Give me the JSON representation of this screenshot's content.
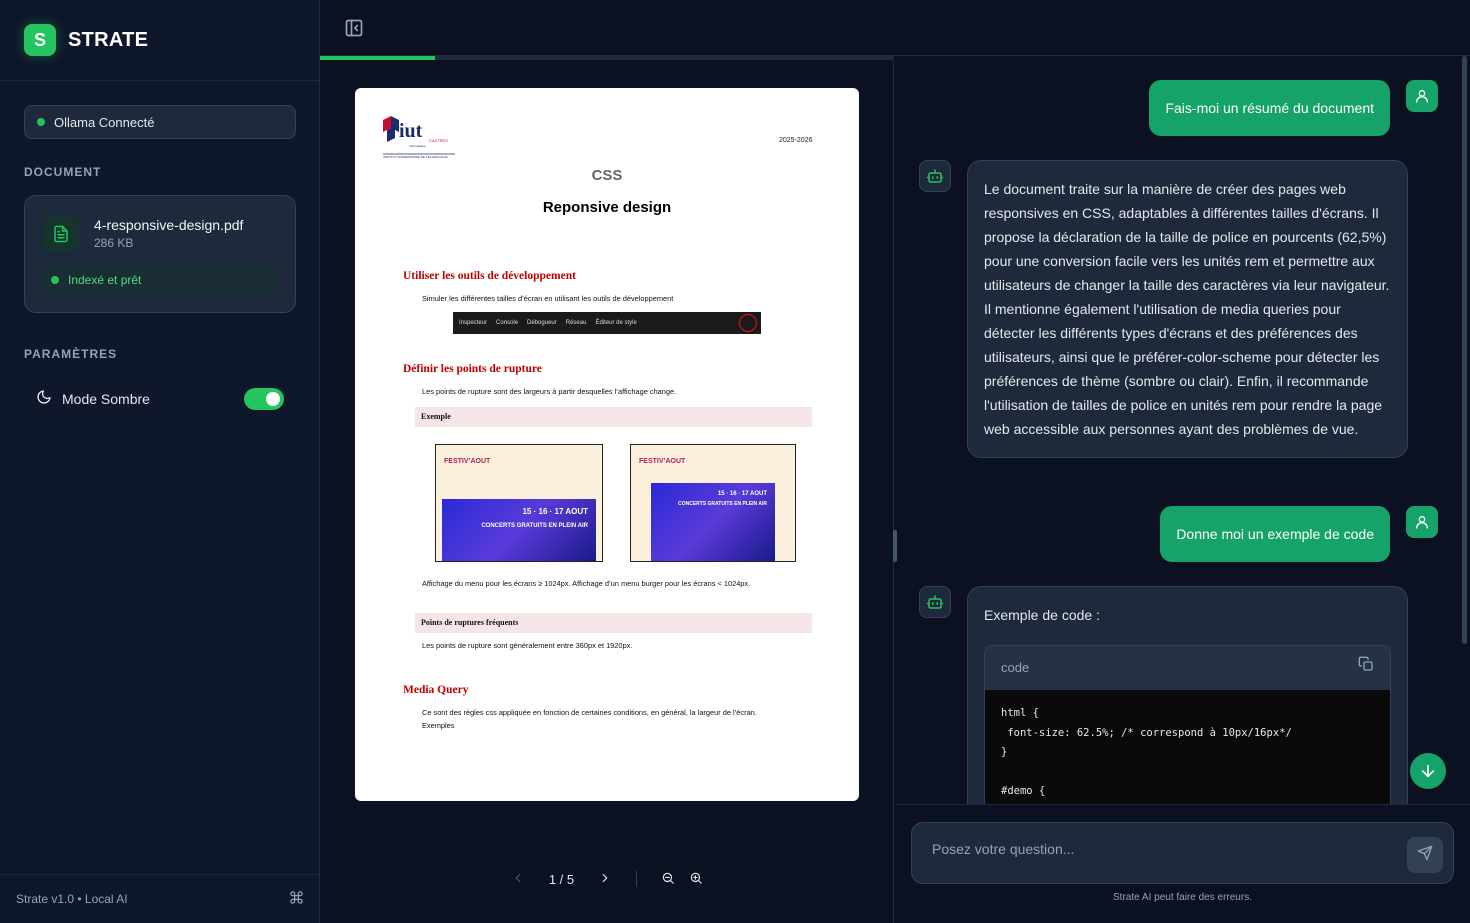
{
  "brand": {
    "logo_letter": "S",
    "name": "STRATE"
  },
  "status": {
    "label": "Ollama Connecté"
  },
  "document_section": {
    "title": "DOCUMENT",
    "file_name": "4-responsive-design.pdf",
    "file_size": "286 KB",
    "state": "Indexé et prêt"
  },
  "settings": {
    "title": "PARAMÈTRES",
    "dark_mode_label": "Mode Sombre",
    "dark_mode_on": true
  },
  "footer": {
    "version": "Strate v1.0 • Local AI"
  },
  "viewer": {
    "progress_fraction": 0.2,
    "page_indicator": "1 / 5",
    "pdf": {
      "logo_text": "iut",
      "logo_sub": "CASTRES",
      "logo_sub2": "Informatique",
      "logo_caption": "INSTITUT UNIVERSITAIRE DE TECHNOLOGIE",
      "year": "2025-2026",
      "title": "CSS",
      "subtitle": "Reponsive design",
      "h1": "Utiliser les outils de développement",
      "p1": "Simuler les différentes tailles d’écran en utilisant les outils de développement",
      "devtools": [
        "Inspecteur",
        "Console",
        "Débogueur",
        "Réseau",
        "Éditeur de style"
      ],
      "h2": "Définir les points de rupture",
      "p2": "Les points de rupture sont des largeurs à partir desquelles l’affichage change.",
      "box1": "Exemple",
      "shot_brand": "FESTIV’AOUT",
      "shot_dates": "15 · 16 · 17 AOUT",
      "shot_tagline": "CONCERTS GRATUITS EN PLEIN AIR",
      "p3": "Affichage du menu pour les écrans ≥ 1024px. Affichage d’un menu burger pour les écrans < 1024px.",
      "box2": "Points de ruptures fréquents",
      "p4": "Les points de rupture sont généralement entre 360px et 1920px.",
      "h3": "Media Query",
      "p5": "Ce sont des règles css appliquée en fonction de certaines conditions, en général, la largeur de l’écran.",
      "p6": "Exemples"
    }
  },
  "chat": {
    "messages": [
      {
        "role": "user",
        "text": "Fais-moi un résumé du document"
      },
      {
        "role": "assistant",
        "text": "Le document traite sur la manière de créer des pages web responsives en CSS, adaptables à différentes tailles d'écrans. Il propose la déclaration de la taille de police en pourcents (62,5%) pour une conversion facile vers les unités rem et permettre aux utilisateurs de changer la taille des caractères via leur navigateur. Il mentionne également l'utilisation de media queries pour détecter les différents types d'écrans et des préférences des utilisateurs, ainsi que le préférer-color-scheme pour détecter les préférences de thème (sombre ou clair). Enfin, il recommande l'utilisation de tailles de police en unités rem pour rendre la page web accessible aux personnes ayant des problèmes de vue."
      },
      {
        "role": "user",
        "text": "Donne moi un exemple de code"
      },
      {
        "role": "assistant",
        "text": "Exemple de code :",
        "code_label": "code",
        "code": "html {\n font-size: 62.5%; /* correspond à 10px/16px*/\n}\n\n#demo {"
      }
    ],
    "input_placeholder": "Posez votre question...",
    "disclaimer": "Strate AI peut faire des erreurs."
  },
  "icons": {
    "brand": "logo-icon",
    "document": "file-text-icon",
    "moon": "moon-icon",
    "command": "command-icon",
    "sidebar_toggle": "panel-left-icon",
    "user": "user-icon",
    "bot": "bot-icon",
    "copy": "copy-icon",
    "send": "send-icon",
    "scroll_down": "arrow-down-icon",
    "prev": "chevron-left-icon",
    "next": "chevron-right-icon",
    "zoom_out": "zoom-out-icon",
    "zoom_in": "zoom-in-icon"
  },
  "colors": {
    "accent": "#22c55e",
    "accent_dark": "#16a36a",
    "background": "#0b1120",
    "panel": "#1e293b"
  }
}
